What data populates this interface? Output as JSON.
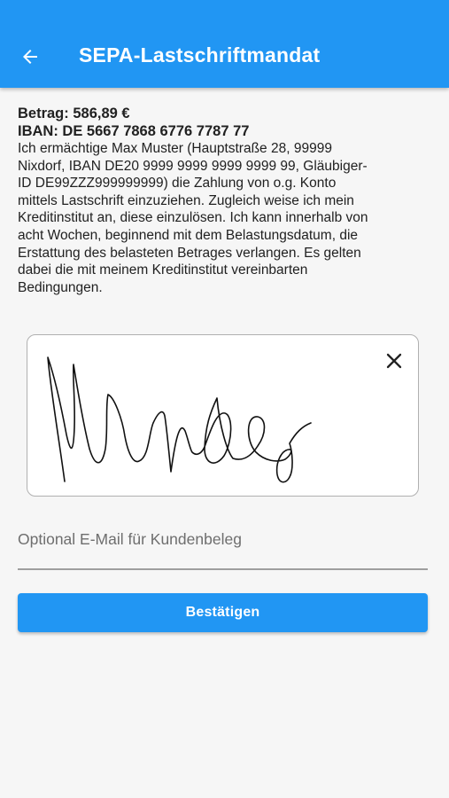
{
  "app_bar": {
    "title": "SEPA-Lastschriftmandat",
    "back_icon": "arrow-left-icon",
    "background_color": "#2196f3"
  },
  "mandate": {
    "amount_line": "Betrag: 586,89 €",
    "iban_line": "IBAN: DE 5667 7868 6776 7787 77",
    "text": "Ich ermächtige Max Muster (Hauptstraße 28, 99999 Nixdorf, IBAN DE20 9999 9999 9999 9999 99, Gläubiger-ID DE99ZZZ999999999) die Zahlung von o.g. Konto mittels Lastschrift einzuziehen. Zugleich weise ich mein Kreditinstitut an, diese einzulösen. Ich kann innerhalb von acht Wochen, beginnend mit dem Belastungsdatum, die Erstattung des belasteten Betrages verlangen. Es gelten dabei die mit meinem Kreditinstitut vereinbarten Bedingungen."
  },
  "signature": {
    "clear_icon": "close-icon"
  },
  "email": {
    "placeholder": "Optional E-Mail für Kundenbeleg",
    "value": ""
  },
  "confirm": {
    "label": "Bestätigen",
    "color": "#2196f3"
  }
}
